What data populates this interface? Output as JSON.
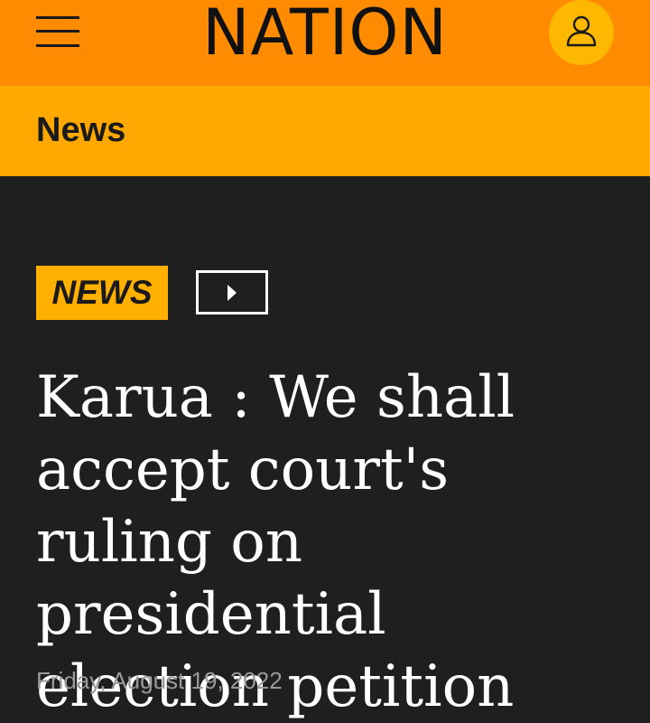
{
  "header": {
    "logo_text": "NATION",
    "menu_icon": "hamburger-menu-icon",
    "user_icon": "user-account-icon",
    "accent_color": "#ff8c00"
  },
  "section": {
    "title": "News",
    "background_color": "#ffa800"
  },
  "article": {
    "category_tag": "NEWS",
    "media_icon": "video-play-icon",
    "headline": "Karua : We shall accept court's ruling on presidential election petition",
    "date": "Friday, August 19, 2022"
  }
}
